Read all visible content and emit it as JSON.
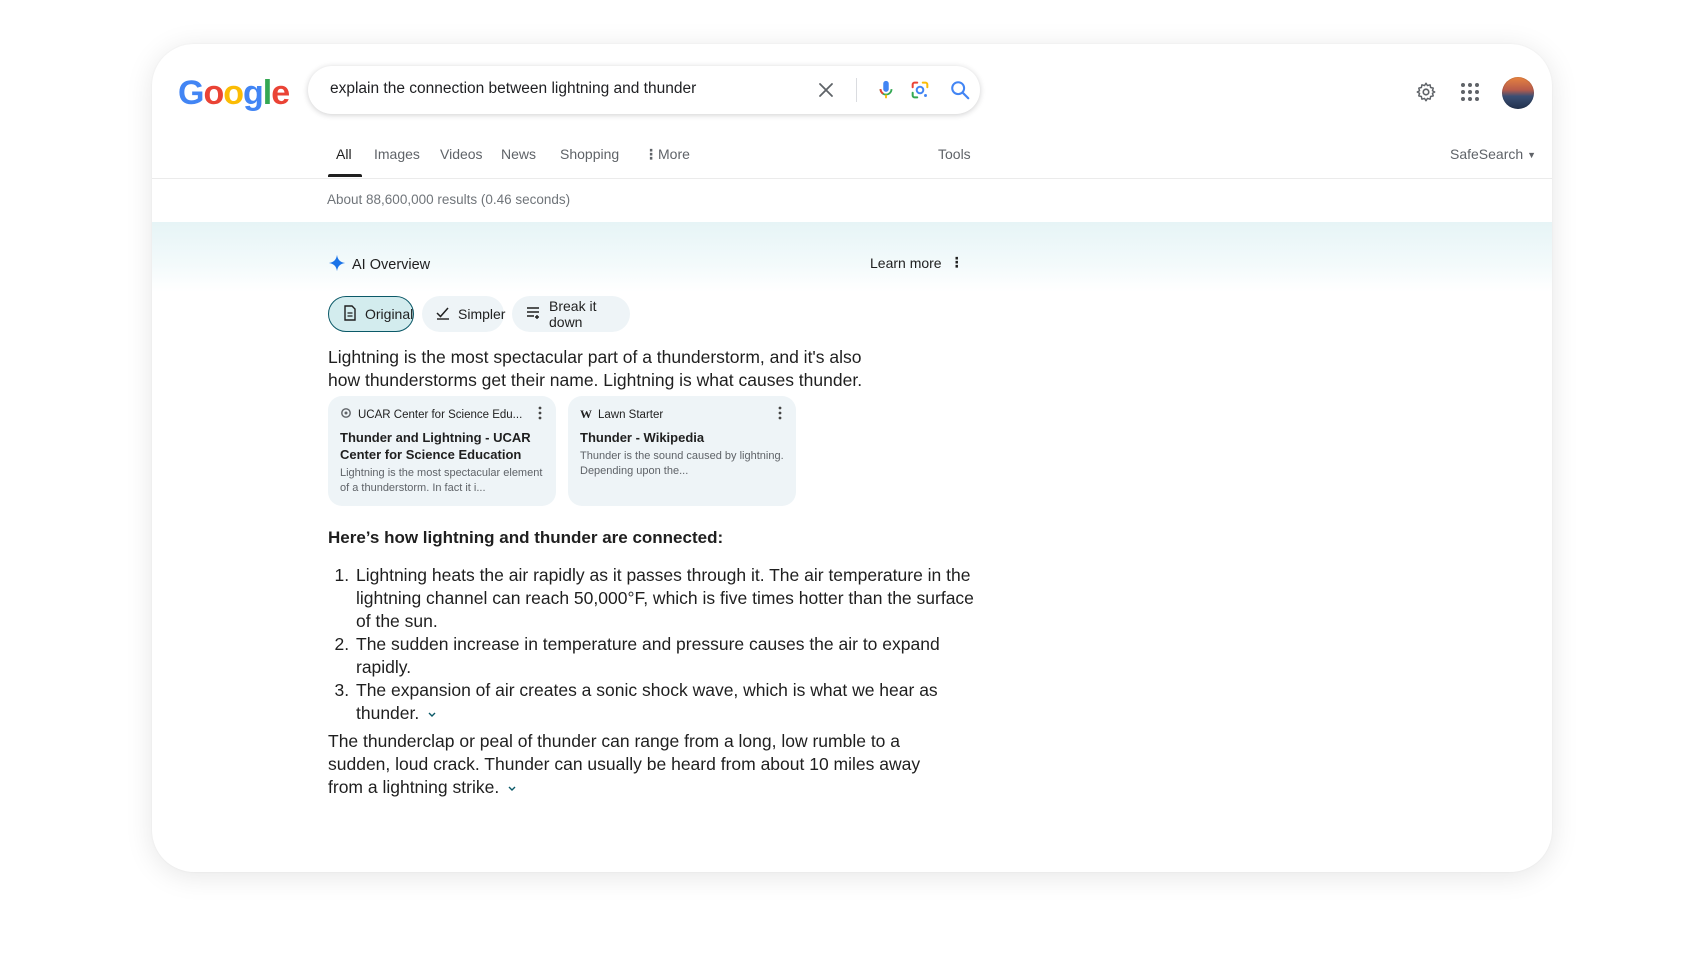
{
  "header": {
    "logo_letters": [
      "G",
      "o",
      "o",
      "g",
      "l",
      "e"
    ],
    "logo_colors": [
      "#4285F4",
      "#EA4335",
      "#FBBC05",
      "#4285F4",
      "#34A853",
      "#EA4335"
    ],
    "search_query": "explain the connection between lightning and thunder",
    "icons": [
      "close-icon",
      "mic-icon",
      "lens-icon",
      "search-icon",
      "gear-icon",
      "apps-grid-icon",
      "avatar"
    ]
  },
  "tabs": {
    "items": [
      {
        "label": "All",
        "active": true
      },
      {
        "label": "Images"
      },
      {
        "label": "Videos"
      },
      {
        "label": "News"
      },
      {
        "label": "Shopping"
      },
      {
        "label": "More"
      }
    ],
    "tools_label": "Tools",
    "safesearch_label": "SafeSearch"
  },
  "results_count": "About 88,600,000 results (0.46 seconds)",
  "ai_overview": {
    "title": "AI Overview",
    "learn_more": "Learn more",
    "chips": [
      {
        "label": "Original",
        "selected": true
      },
      {
        "label": "Simpler"
      },
      {
        "label": "Break it down"
      }
    ],
    "intro": "Lightning is the most spectacular part of a thunderstorm, and it's also how thunderstorms get their name. Lightning is what causes thunder.",
    "sources": [
      {
        "site": "UCAR Center for Science Edu...",
        "title": "Thunder and Lightning - UCAR Center for Science Education",
        "snippet": "Lightning is the most spectacular element of a thunderstorm. In fact it i..."
      },
      {
        "site": "Lawn Starter",
        "title": "Thunder - Wikipedia",
        "snippet": "Thunder is the sound caused by lightning. Depending upon the..."
      }
    ],
    "subheading": "Here’s how lightning and thunder are connected:",
    "steps": [
      "Lightning heats the air rapidly as it passes through it. The air temperature in the lightning channel can reach 50,000°F, which is five times hotter than the surface of the sun.",
      "The sudden increase in temperature and pressure causes the air to expand rapidly.",
      "The expansion of air creates a sonic shock wave, which is what we hear as thunder."
    ],
    "closing": "The thunderclap or peal of thunder can range from a long, low rumble to a sudden, loud crack. Thunder can usually be heard from about 10 miles away from a lightning strike."
  },
  "colors": {
    "accent_teal": "#0b5968",
    "chip_bg": "#eef4f7",
    "selected_chip_bg": "#d3ecee",
    "mic_blue": "#4285F4"
  }
}
